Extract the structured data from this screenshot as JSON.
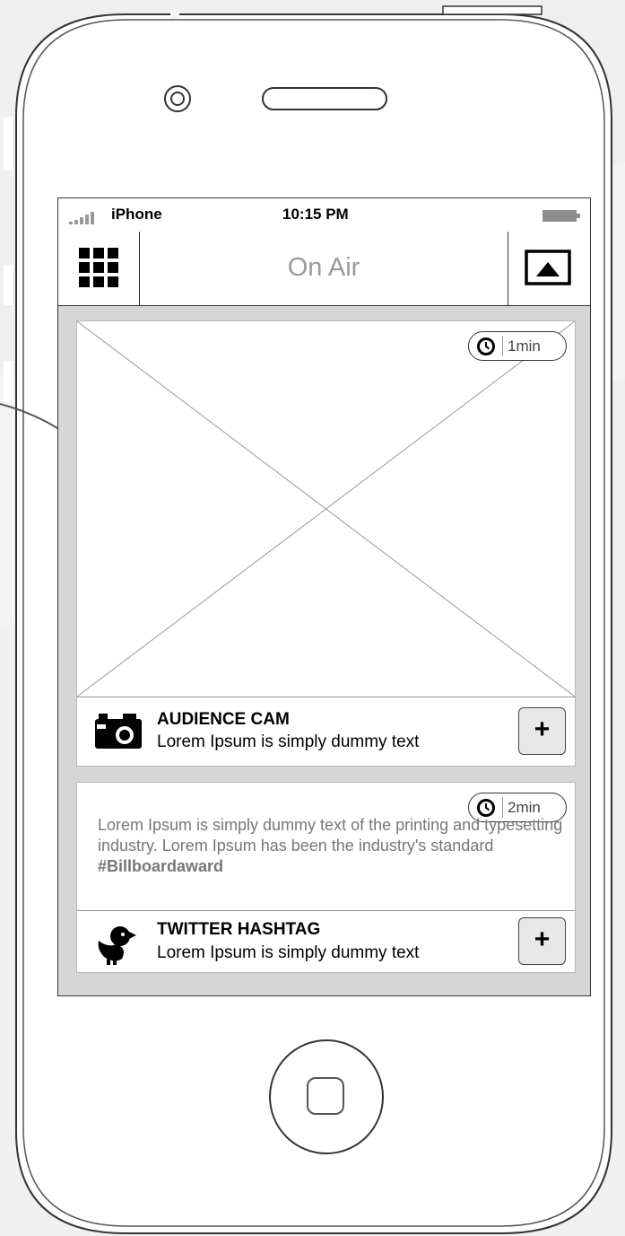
{
  "status_bar": {
    "carrier": "iPhone",
    "time": "10:15 PM"
  },
  "nav_bar": {
    "title": "On Air"
  },
  "feed": {
    "audience_cam": {
      "duration": "1min",
      "title": "AUDIENCE CAM",
      "description": "Lorem Ipsum is simply dummy text",
      "add_label": "+"
    },
    "twitter": {
      "duration": "2min",
      "tweet_text": "Lorem Ipsum is simply dummy text of the printing and typesetting industry. Lorem Ipsum has been the industry's standard ",
      "hashtag": "#Billboardaward",
      "title": "TWITTER HASHTAG",
      "description": "Lorem Ipsum is simply dummy text",
      "add_label": "+"
    }
  },
  "icons": {
    "menu": "grid-icon",
    "airplay": "airplay-icon",
    "clock": "clock-icon",
    "camera": "camera-icon",
    "bird": "bird-icon",
    "battery": "battery-icon",
    "signal": "signal-icon"
  }
}
